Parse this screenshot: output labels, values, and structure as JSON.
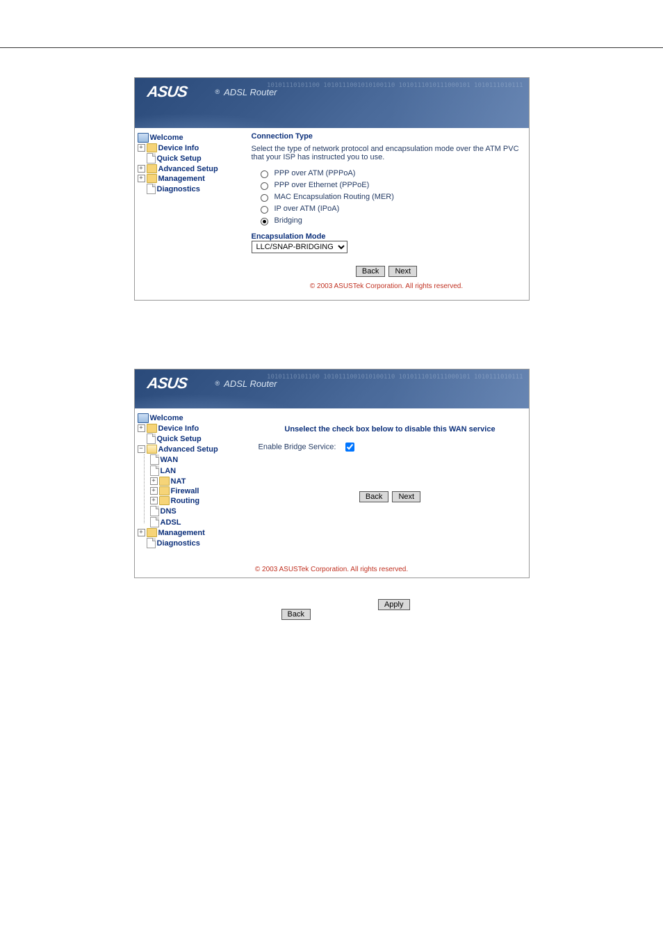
{
  "brand": {
    "name": "ASUS",
    "product": "ADSL Router",
    "reg": "®"
  },
  "hdr_binary": "10101110101100\n1010111001010100110\n1010111010111000101\n1010111010111",
  "nav1": {
    "welcome": "Welcome",
    "device_info": "Device Info",
    "quick_setup": "Quick Setup",
    "advanced_setup": "Advanced Setup",
    "management": "Management",
    "diagnostics": "Diagnostics"
  },
  "pane1": {
    "title": "Connection Type",
    "desc": "Select the type of network protocol and encapsulation mode over the ATM PVC that your ISP has instructed you to use.",
    "opts": [
      "PPP over ATM (PPPoA)",
      "PPP over Ethernet (PPPoE)",
      "MAC Encapsulation Routing (MER)",
      "IP over ATM (IPoA)",
      "Bridging"
    ],
    "selected_index": 4,
    "encap_title": "Encapsulation Mode",
    "encap_value": "LLC/SNAP-BRIDGING",
    "back": "Back",
    "next": "Next",
    "copyright": "© 2003 ASUSTek Corporation. All rights reserved."
  },
  "nav2": {
    "welcome": "Welcome",
    "device_info": "Device Info",
    "quick_setup": "Quick Setup",
    "advanced_setup": "Advanced Setup",
    "wan": "WAN",
    "lan": "LAN",
    "nat": "NAT",
    "firewall": "Firewall",
    "routing": "Routing",
    "dns": "DNS",
    "adsl": "ADSL",
    "management": "Management",
    "diagnostics": "Diagnostics"
  },
  "pane2": {
    "instr": "Unselect the check box below to disable this WAN service",
    "label": "Enable Bridge Service:",
    "checked": true,
    "back": "Back",
    "next": "Next",
    "copyright": "© 2003 ASUSTek Corporation. All rights reserved."
  },
  "buttons": {
    "apply": "Apply",
    "back": "Back"
  }
}
